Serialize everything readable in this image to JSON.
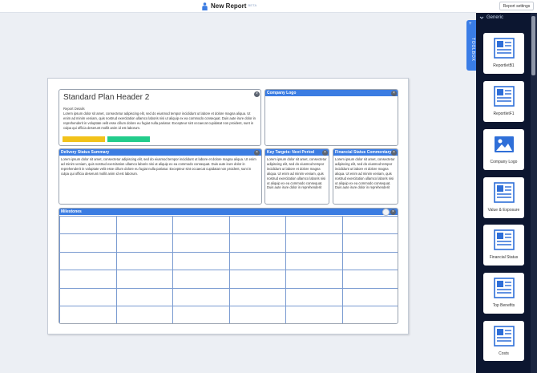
{
  "header": {
    "title": "New Report",
    "badge": "BETA",
    "settings_label": "Report settings"
  },
  "toolbox": {
    "tab_label": "TOOLBOX",
    "plus": "+",
    "section_label": "Generic",
    "items": [
      {
        "label": "ReportletB1",
        "icon": "reportlet-b1-icon"
      },
      {
        "label": "ReportletF1",
        "icon": "reportlet-f1-icon"
      },
      {
        "label": "Company Logo",
        "icon": "image-icon"
      },
      {
        "label": "Value & Exposure",
        "icon": "value-exposure-icon"
      },
      {
        "label": "Financial Status",
        "icon": "financial-status-icon"
      },
      {
        "label": "Top Benefits",
        "icon": "top-benefits-icon"
      },
      {
        "label": "Costs",
        "icon": "costs-icon"
      }
    ]
  },
  "report": {
    "plan": {
      "title": "Standard Plan Header 2",
      "details_label": "Report Details",
      "text": "Lorem ipsum dolor sit amet, consectetur adipiscing elit, sed do eiusmod tempor incididunt ut labore et dolore magna aliqua. Ut enim ad minim veniam, quis nostrud exercitation ullamco laboris nisi ut aliquip ex ea commodo consequat. Duis aute irure dolor in reprehenderit in voluptate velit esse cillum dolore eu fugiat nulla pariatur. Excepteur sint occaecat cupidatat non proident, sunt in culpa qui officia deserunt mollit anim id est laborum.",
      "colors": {
        "yellow": "#f2c21a",
        "green": "#22cc8b"
      }
    },
    "company_logo": {
      "title": "Company Logo"
    },
    "delivery": {
      "title": "Delivery Status Summary",
      "text": "Lorem ipsum dolor sit amet, consectetur adipiscing elit, sed do eiusmod tempor incididunt ut labore et dolore magna aliqua. Ut enim ad minim veniam, quis nostrud exercitation ullamco laboris nisi ut aliquip ex ea commodo consequat. Duis aute irure dolor in reprehenderit in voluptate velit esse cillum dolore eu fugiat nulla pariatur. Excepteur sint occaecat cupidatat non proident, sunt in culpa qui officia deserunt mollit anim id est laborum."
    },
    "key_targets": {
      "title": "Key Targets: Next Period",
      "text": "Lorem ipsum dolor sit amet, consectetur adipiscing elit, sed do eiusmod tempor incididunt ut labore et dolore magna aliqua. Ut enim ad minim veniam, quis nostrud exercitation ullamco laboris nisi ut aliquip ex ea commodo consequat. Duis aute irure dolor in reprehenderit"
    },
    "financial": {
      "title": "Financial Status Commentary",
      "text": "Lorem ipsum dolor sit amet, consectetur adipiscing elit, sed do eiusmod tempor incididunt ut labore et dolore magna aliqua. Ut enim ad minim veniam, quis nostrud exercitation ullamco laboris nisi ut aliquip ex ea commodo consequat. Duis aute irure dolor in reprehenderit"
    },
    "milestones": {
      "title": "Milestones",
      "rows": 6,
      "cols": 6
    },
    "close_glyph": "×"
  },
  "theme": {
    "accent": "#3b7ce2",
    "panel_bg": "#0c1630",
    "canvas_bg": "#eceff4"
  }
}
